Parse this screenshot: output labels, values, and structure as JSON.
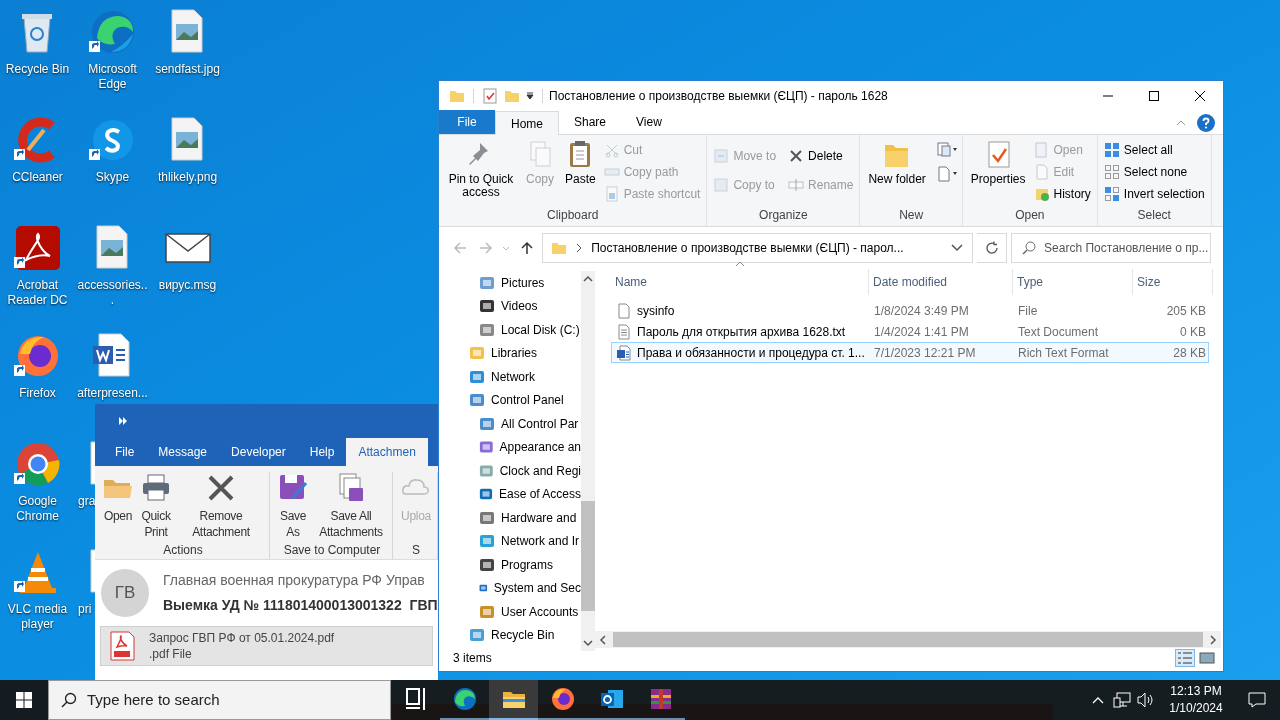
{
  "desktop_icons": [
    {
      "label": "Recycle Bin",
      "shortcut": false
    },
    {
      "label": "CCleaner",
      "shortcut": true
    },
    {
      "label": "Acrobat Reader DC",
      "shortcut": true
    },
    {
      "label": "Firefox",
      "shortcut": true
    },
    {
      "label": "Google Chrome",
      "shortcut": true
    },
    {
      "label": "VLC media player",
      "shortcut": true
    },
    {
      "label": "Microsoft Edge",
      "shortcut": true
    },
    {
      "label": "Skype",
      "shortcut": true
    },
    {
      "label": "accessories...",
      "shortcut": false
    },
    {
      "label": "afterpresen...",
      "shortcut": false
    },
    {
      "label": "gra",
      "shortcut": false
    },
    {
      "label": "pri",
      "shortcut": false
    },
    {
      "label": "sendfast.jpg",
      "shortcut": false
    },
    {
      "label": "thlikely.png",
      "shortcut": false
    },
    {
      "label": "вирус.msg",
      "shortcut": false
    }
  ],
  "outlook": {
    "tabs": [
      {
        "label": "File",
        "selected": false
      },
      {
        "label": "Message",
        "selected": false
      },
      {
        "label": "Developer",
        "selected": false
      },
      {
        "label": "Help",
        "selected": false
      },
      {
        "label": "Attachmen",
        "selected": true
      }
    ],
    "groups": [
      {
        "label": "Actions",
        "buttons": [
          {
            "label": "Open",
            "disabled": false
          },
          {
            "label": "Quick Print",
            "disabled": false
          },
          {
            "label": "Remove Attachment",
            "disabled": false
          }
        ]
      },
      {
        "label": "Save to Computer",
        "buttons": [
          {
            "label": "Save As",
            "disabled": false
          },
          {
            "label": "Save All Attachments",
            "disabled": false
          }
        ]
      },
      {
        "label": "S",
        "buttons": [
          {
            "label": "Uploa",
            "disabled": true
          }
        ]
      }
    ],
    "avatar": "ГВ",
    "sender": "Главная военная прокуратура РФ Управ",
    "subject": "Выемка УД № 111801400013001322  ГВП",
    "attachment": {
      "name": "Запрос ГВП РФ от 05.01.2024.pdf",
      "type": ".pdf File"
    }
  },
  "explorer": {
    "title": "Постановление о производстве выемки (ЄЦП) - пароль 1628",
    "tabs": [
      {
        "label": "File",
        "selected": false
      },
      {
        "label": "Home",
        "selected": true
      },
      {
        "label": "Share",
        "selected": false
      },
      {
        "label": "View",
        "selected": false
      }
    ],
    "groups": [
      {
        "label": "Clipboard",
        "large": [
          {
            "label": "Pin to Quick access",
            "disabled": false
          },
          {
            "label": "Copy",
            "disabled": true
          },
          {
            "label": "Paste",
            "disabled": false
          }
        ],
        "small": [
          {
            "label": "Cut",
            "disabled": true
          },
          {
            "label": "Copy path",
            "disabled": true
          },
          {
            "label": "Paste shortcut",
            "disabled": true
          }
        ]
      },
      {
        "label": "Organize",
        "small": [
          {
            "label": "Move to",
            "disabled": true
          },
          {
            "label": "Copy to",
            "disabled": true
          },
          {
            "label": "Delete",
            "disabled": false
          },
          {
            "label": "Rename",
            "disabled": true
          }
        ]
      },
      {
        "label": "New",
        "large": [
          {
            "label": "New folder",
            "disabled": false
          }
        ]
      },
      {
        "label": "Open",
        "large": [
          {
            "label": "Properties",
            "disabled": false
          }
        ],
        "small": [
          {
            "label": "Open",
            "disabled": true
          },
          {
            "label": "Edit",
            "disabled": true
          },
          {
            "label": "History",
            "disabled": false
          }
        ]
      },
      {
        "label": "Select",
        "small": [
          {
            "label": "Select all",
            "disabled": false
          },
          {
            "label": "Select none",
            "disabled": false
          },
          {
            "label": "Invert selection",
            "disabled": false
          }
        ]
      }
    ],
    "address": "Постановление о производстве выемки (ЄЦП) - парол...",
    "search": {
      "placeholder": "Search Постановление о пр..."
    },
    "nav": [
      {
        "children": [
          {
            "label": "Pictures"
          },
          {
            "label": "Videos"
          },
          {
            "label": "Local Disk (C:)"
          }
        ]
      },
      {
        "label": "Libraries"
      },
      {
        "label": "Network"
      },
      {
        "label": "Control Panel",
        "children": [
          {
            "label": "All Control Par"
          },
          {
            "label": "Appearance an"
          },
          {
            "label": "Clock and Regi"
          },
          {
            "label": "Ease of Access"
          },
          {
            "label": "Hardware and"
          },
          {
            "label": "Network and Ir"
          },
          {
            "label": "Programs"
          },
          {
            "label": "System and Sec"
          },
          {
            "label": "User Accounts"
          }
        ]
      },
      {
        "label": "Recycle Bin"
      }
    ],
    "columns": [
      "Name",
      "Date modified",
      "Type",
      "Size"
    ],
    "rows": [
      {
        "kind": "file",
        "name": "sysinfo",
        "date": "1/8/2024 3:49 PM",
        "type": "File",
        "size": "205 KB",
        "selected": false
      },
      {
        "kind": "text",
        "name": "Пароль для открытия архива 1628.txt",
        "date": "1/4/2024 1:41 PM",
        "type": "Text Document",
        "size": "0 KB",
        "selected": false
      },
      {
        "kind": "rtf",
        "name": "Права и обязанности и процедура ст. 1...",
        "date": "7/1/2023 12:21 PM",
        "type": "Rich Text Format",
        "size": "28 KB",
        "selected": true
      }
    ],
    "status": "3 items"
  },
  "taskbar": {
    "search_placeholder": "Type here to search",
    "apps": [
      {
        "selected": false
      },
      {
        "selected": false
      },
      {
        "selected": true
      },
      {
        "selected": false
      },
      {
        "selected": false
      },
      {
        "selected": false
      }
    ],
    "time": "12:13 PM",
    "date": "1/10/2024"
  }
}
